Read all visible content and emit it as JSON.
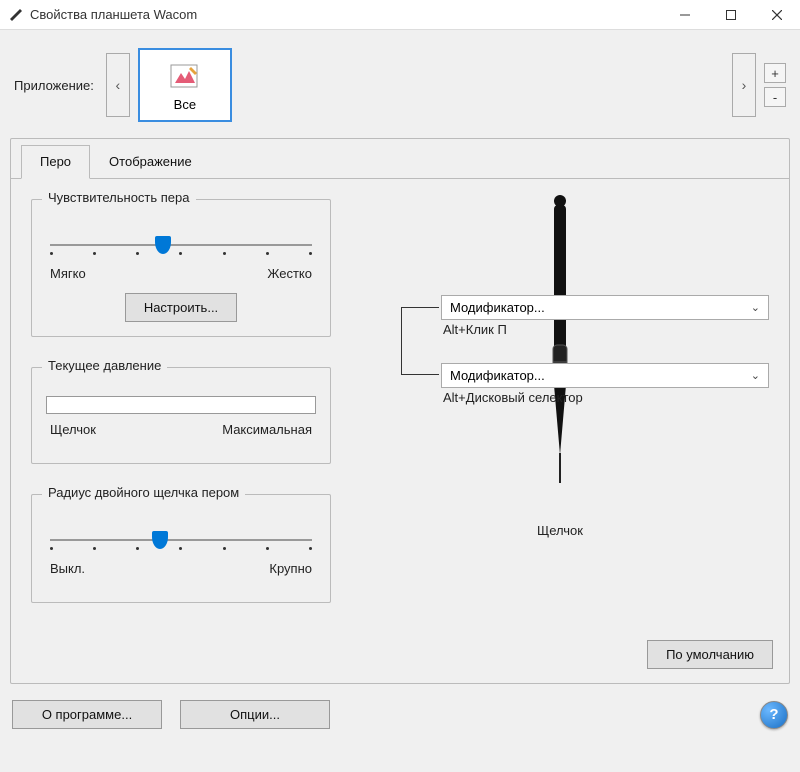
{
  "window": {
    "title": "Свойства планшета Wacom"
  },
  "application": {
    "label": "Приложение:",
    "selected": "Все"
  },
  "plusminus": {
    "plus": "+",
    "minus": "-"
  },
  "tabs": {
    "pen": "Перо",
    "mapping": "Отображение"
  },
  "sensitivity": {
    "title": "Чувствительность пера",
    "soft": "Мягко",
    "firm": "Жестко",
    "customize": "Настроить...",
    "value_percent": 43
  },
  "pressure": {
    "title": "Текущее давление",
    "click": "Щелчок",
    "max": "Максимальная"
  },
  "doubleclick": {
    "title": "Радиус двойного щелчка пером",
    "off": "Выкл.",
    "large": "Крупно",
    "value_percent": 42
  },
  "pen": {
    "upper_dd": "Модификатор...",
    "upper_sub": "Alt+Клик П",
    "lower_dd": "Модификатор...",
    "lower_sub": "Alt+Дисковый селектор",
    "tip_label": "Щелчок"
  },
  "buttons": {
    "default": "По умолчанию",
    "about": "О программе...",
    "options": "Опции..."
  }
}
